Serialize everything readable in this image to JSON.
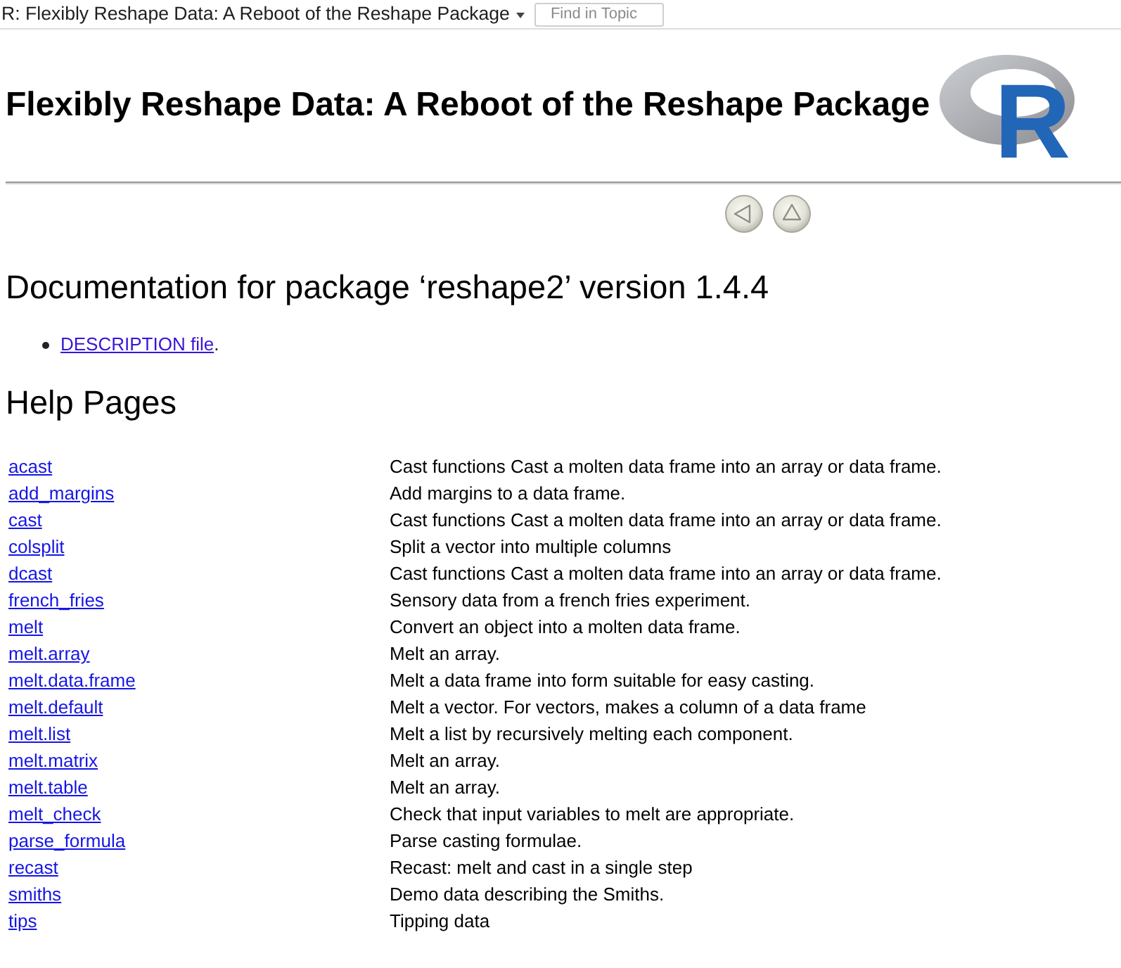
{
  "toolbar": {
    "title": "R: Flexibly Reshape Data: A Reboot of the Reshape Package",
    "search": {
      "placeholder": "Find in Topic"
    }
  },
  "header": {
    "title": "Flexibly Reshape Data: A Reboot of the Reshape Package",
    "logo_text": "R"
  },
  "documentation": {
    "heading": "Documentation for package ‘reshape2’ version 1.4.4",
    "items": [
      {
        "link": "DESCRIPTION file",
        "after": "."
      }
    ]
  },
  "help_pages": {
    "heading": "Help Pages",
    "rows": [
      {
        "topic": "acast",
        "description": "Cast functions Cast a molten data frame into an array or data frame."
      },
      {
        "topic": "add_margins",
        "description": "Add margins to a data frame."
      },
      {
        "topic": "cast",
        "description": "Cast functions Cast a molten data frame into an array or data frame."
      },
      {
        "topic": "colsplit",
        "description": "Split a vector into multiple columns"
      },
      {
        "topic": "dcast",
        "description": "Cast functions Cast a molten data frame into an array or data frame."
      },
      {
        "topic": "french_fries",
        "description": "Sensory data from a french fries experiment."
      },
      {
        "topic": "melt",
        "description": "Convert an object into a molten data frame."
      },
      {
        "topic": "melt.array",
        "description": "Melt an array."
      },
      {
        "topic": "melt.data.frame",
        "description": "Melt a data frame into form suitable for easy casting."
      },
      {
        "topic": "melt.default",
        "description": "Melt a vector. For vectors, makes a column of a data frame"
      },
      {
        "topic": "melt.list",
        "description": "Melt a list by recursively melting each component."
      },
      {
        "topic": "melt.matrix",
        "description": "Melt an array."
      },
      {
        "topic": "melt.table",
        "description": "Melt an array."
      },
      {
        "topic": "melt_check",
        "description": "Check that input variables to melt are appropriate."
      },
      {
        "topic": "parse_formula",
        "description": "Parse casting formulae."
      },
      {
        "topic": "recast",
        "description": "Recast: melt and cast in a single step"
      },
      {
        "topic": "smiths",
        "description": "Demo data describing the Smiths."
      },
      {
        "topic": "tips",
        "description": "Tipping data"
      }
    ]
  }
}
